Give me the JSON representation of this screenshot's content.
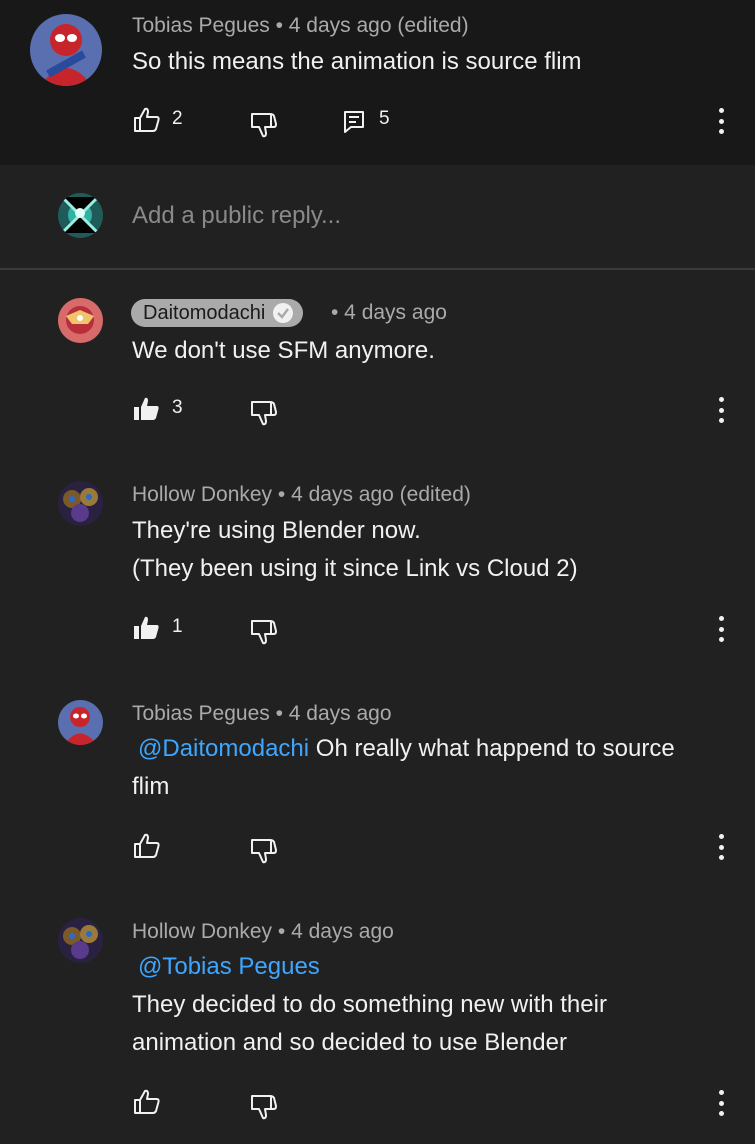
{
  "top_comment": {
    "author": "Tobias Pegues",
    "meta": "Tobias Pegues • 4 days ago (edited)",
    "text": "So this means the animation is source flim",
    "likes": "2",
    "replies": "5"
  },
  "reply_box": {
    "placeholder": "Add a public reply..."
  },
  "replies": [
    {
      "author": "Daitomodachi",
      "time": "• 4 days ago",
      "text": "We don't use SFM anymore.",
      "likes": "3",
      "liked": true
    },
    {
      "meta": "Hollow Donkey • 4 days ago (edited)",
      "line1": "They're using Blender now.",
      "line2": "(They been using it since Link vs Cloud 2)",
      "likes": "1",
      "liked": true
    },
    {
      "meta": "Tobias Pegues • 4 days ago",
      "mention": "@Daitomodachi",
      "line1": " Oh really what happend to source",
      "line2": "flim"
    },
    {
      "meta": "Hollow Donkey • 4 days ago",
      "mention": "@Tobias Pegues",
      "line1": "They decided to do something new with their",
      "line2": "animation and so decided to use Blender"
    }
  ],
  "icons": {
    "like": "thumbs-up-icon",
    "dislike": "thumbs-down-icon",
    "reply": "comment-icon",
    "more": "more-vertical-icon",
    "verified": "check-badge-icon"
  },
  "colors": {
    "background": "#212121",
    "top_background": "#181818",
    "text": "#f1f1f1",
    "meta": "#aaaaaa",
    "link": "#3ea6ff"
  }
}
